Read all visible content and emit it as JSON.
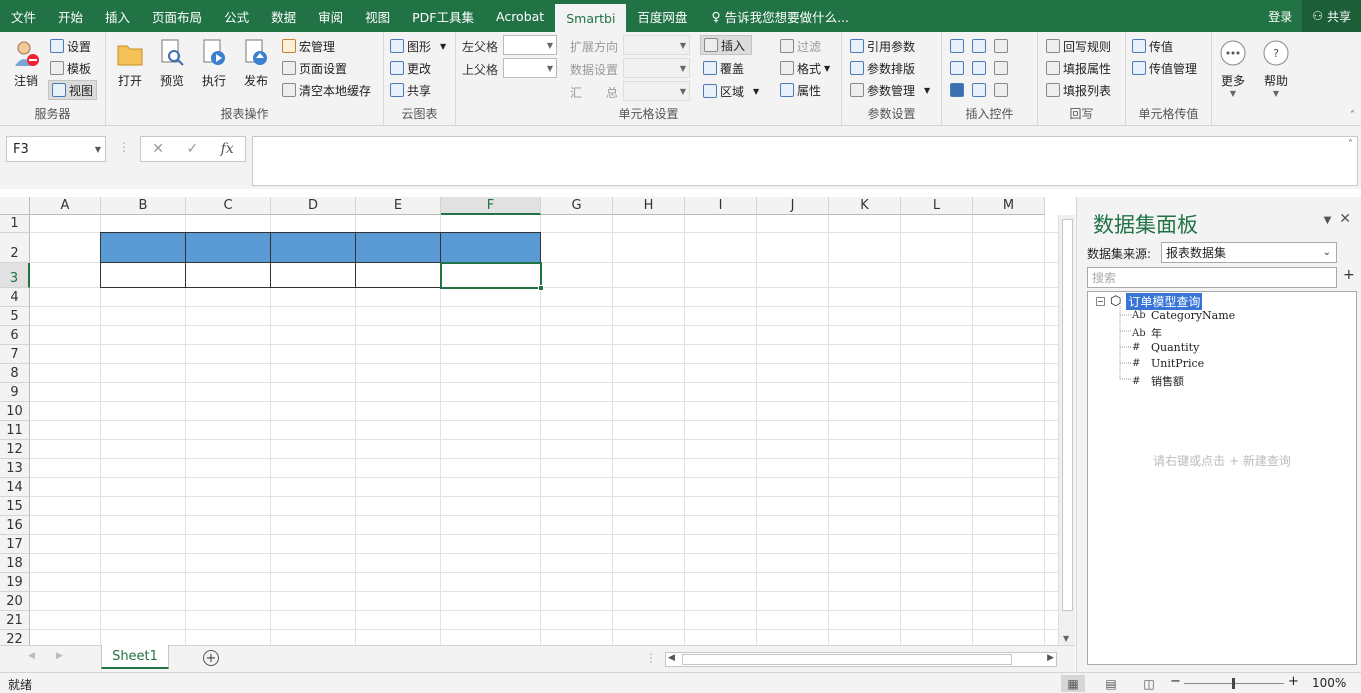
{
  "tabs": [
    "文件",
    "开始",
    "插入",
    "页面布局",
    "公式",
    "数据",
    "审阅",
    "视图",
    "PDF工具集",
    "Acrobat",
    "Smartbi",
    "百度网盘"
  ],
  "active_tab": "Smartbi",
  "tell_me": "告诉我您想要做什么...",
  "login": "登录",
  "share": "共享",
  "ribbon": {
    "server": {
      "label": "服务器",
      "logout": "注销",
      "settings": "设置",
      "template": "模板",
      "view": "视图"
    },
    "report": {
      "label": "报表操作",
      "open": "打开",
      "preview": "预览",
      "execute": "执行",
      "publish": "发布",
      "macro": "宏管理",
      "page_setup": "页面设置",
      "clear_cache": "清空本地缓存"
    },
    "cloud": {
      "label": "云图表",
      "chart": "图形",
      "change": "更改",
      "share": "共享"
    },
    "cell": {
      "label": "单元格设置",
      "left_parent": "左父格",
      "top_parent": "上父格",
      "expand_dir": "扩展方向",
      "data_setting": "数据设置",
      "summary": "汇　　总",
      "insert": "插入",
      "cover": "覆盖",
      "area": "区域",
      "filter": "过滤",
      "format": "格式",
      "property": "属性"
    },
    "param": {
      "label": "参数设置",
      "ref": "引用参数",
      "layout": "参数排版",
      "manage": "参数管理"
    },
    "controls": {
      "label": "插入控件"
    },
    "writeback": {
      "label": "回写",
      "rules": "回写规则",
      "fill_prop": "填报属性",
      "fill_list": "填报列表"
    },
    "pass": {
      "label": "单元格传值",
      "pass": "传值",
      "manage": "传值管理"
    },
    "more": "更多",
    "help": "帮助"
  },
  "namebox": "F3",
  "columns": [
    "A",
    "B",
    "C",
    "D",
    "E",
    "F",
    "G",
    "H",
    "I",
    "J",
    "K",
    "L",
    "M"
  ],
  "selected_column": "F",
  "rows": [
    "1",
    "2",
    "3",
    "4",
    "5",
    "6",
    "7",
    "8",
    "9",
    "10",
    "11",
    "12",
    "13",
    "14",
    "15",
    "16",
    "17",
    "18",
    "19",
    "20",
    "21",
    "22"
  ],
  "selected_row": "3",
  "sheet": "Sheet1",
  "panel": {
    "title": "数据集面板",
    "source_label": "数据集来源:",
    "source_value": "报表数据集",
    "search_placeholder": "搜索",
    "root": "订单模型查询",
    "fields": [
      {
        "type": "Ab",
        "name": "CategoryName"
      },
      {
        "type": "Ab",
        "name": "年"
      },
      {
        "type": "#",
        "name": "Quantity"
      },
      {
        "type": "#",
        "name": "UnitPrice"
      },
      {
        "type": "#",
        "name": "销售额"
      }
    ],
    "hint": "请右键或点击 + 新建查询"
  },
  "status": "就绪",
  "zoom": "100%"
}
